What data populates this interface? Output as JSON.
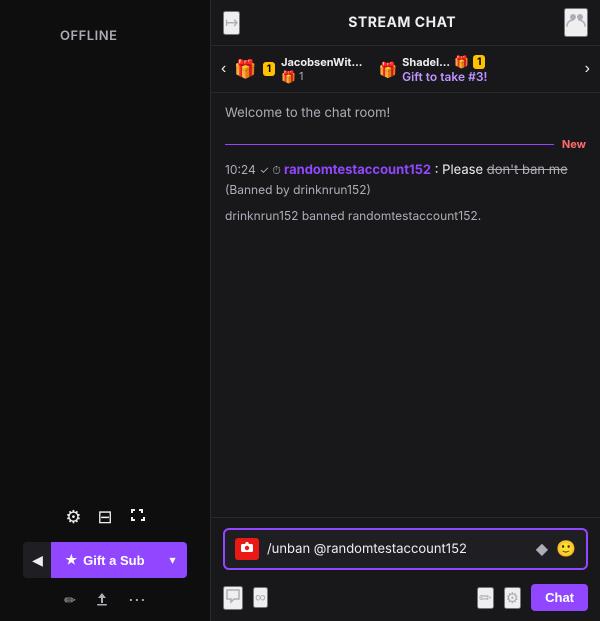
{
  "leftPanel": {
    "offlineLabel": "OFFLINE",
    "icons": {
      "settings": "⚙",
      "layout": "⊞",
      "fullscreen": "⛶"
    },
    "giftSub": {
      "arrowLeft": "◀",
      "starIcon": "★",
      "label": "Gift a Sub",
      "dropdownArrow": "▾"
    },
    "actionIcons": {
      "pencil": "✏",
      "upload": "⬆",
      "more": "⋯"
    }
  },
  "chatPanel": {
    "header": {
      "popoutIcon": "↦",
      "title": "STREAM CHAT",
      "usersIcon": "👥"
    },
    "giftBanner": {
      "prevBtn": "‹",
      "nextBtn": "›",
      "card1": {
        "giftEmoji": "🎁",
        "badgeNum": "1",
        "username": "JacobsenWit...",
        "giftIcon": "🎁",
        "count": "1"
      },
      "card2": {
        "giftEmoji": "🎁",
        "username": "Shadel...",
        "badgeNum": "1",
        "giftToTake": "Gift to take #3!"
      }
    },
    "messages": {
      "welcome": "Welcome to the chat room!",
      "newLabel": "New",
      "msg1": {
        "time": "10:24",
        "checkIcon": "✓",
        "clockIcon": "⏱",
        "username": "randomtestaccount152",
        "textNormal": ": Please ",
        "textStrike": "don't ban me",
        "textParen": " (Banned by drinknrun152)"
      },
      "msg2": "drinknrun152 banned randomtestaccount152."
    },
    "input": {
      "cameraIcon": "📷",
      "value": "/unban @randomtestaccount152",
      "diamondIcon": "◆",
      "emojiIcon": "🙂"
    },
    "footer": {
      "chatIcon": "💬",
      "infinityIcon": "∞",
      "pencilIcon": "✏",
      "settingsIcon": "⚙",
      "chatBtn": "Chat"
    }
  }
}
